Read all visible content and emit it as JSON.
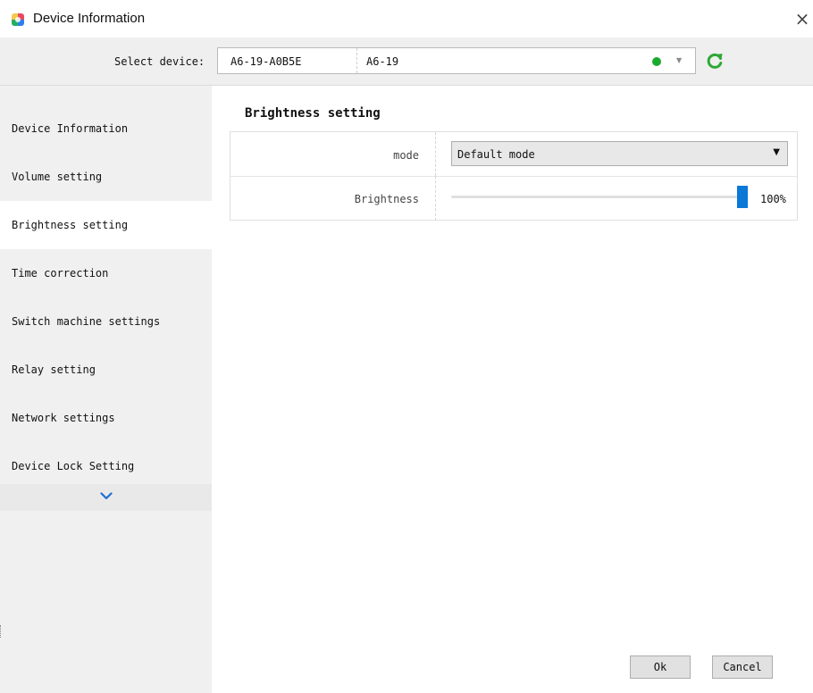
{
  "window": {
    "title": "Device Information",
    "close_glyph": "×"
  },
  "device_bar": {
    "label": "Select device:",
    "device_id": "A6-19-A0B5E",
    "device_name": "A6-19",
    "status_color": "#1aab2e",
    "caret_glyph": "▼",
    "refresh_icon": "refresh-icon",
    "refresh_color": "#2ea836"
  },
  "sidebar": {
    "items": [
      {
        "label": "Device Information",
        "active": false
      },
      {
        "label": "Volume setting",
        "active": false
      },
      {
        "label": "Brightness setting",
        "active": true
      },
      {
        "label": "Time correction",
        "active": false
      },
      {
        "label": "Switch machine settings",
        "active": false
      },
      {
        "label": "Relay setting",
        "active": false
      },
      {
        "label": "Network settings",
        "active": false
      },
      {
        "label": "Device Lock Setting",
        "active": false
      }
    ],
    "more_icon": "chevron-down-icon"
  },
  "content": {
    "section_title": "Brightness setting",
    "mode": {
      "label": "mode",
      "value": "Default mode",
      "caret_glyph": "▼"
    },
    "brightness": {
      "label": "Brightness",
      "level": 1.0,
      "value_text": "100%",
      "accent_color": "#0a78d7"
    }
  },
  "footer": {
    "ok_label": "Ok",
    "cancel_label": "Cancel"
  }
}
